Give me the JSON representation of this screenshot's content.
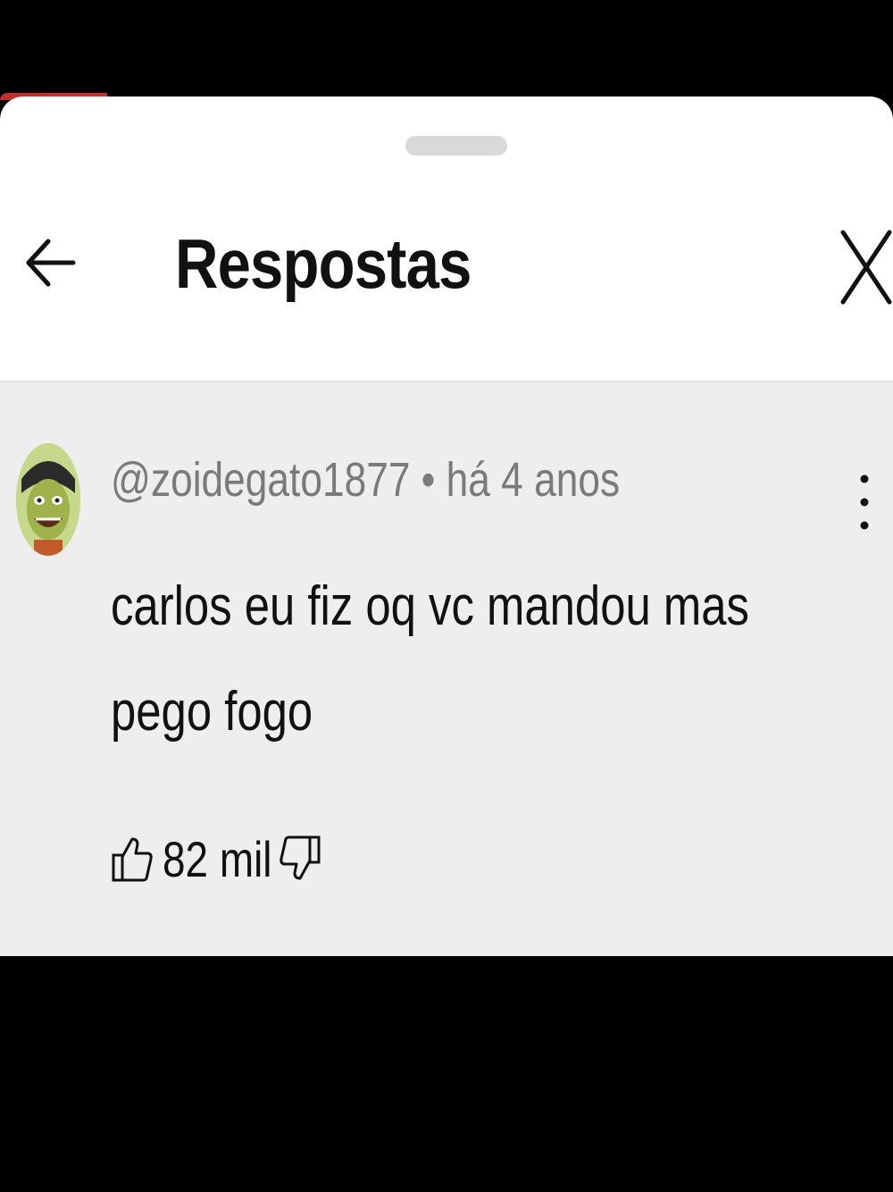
{
  "header": {
    "title": "Respostas",
    "back_icon": "arrow-left-icon",
    "close_icon": "close-icon"
  },
  "comment": {
    "author": "@zoidegato1877",
    "separator": "•",
    "time": "há 4 anos",
    "text": "carlos eu fiz oq vc mandou mas pego fogo",
    "likes": "82 mil",
    "like_icon": "thumbs-up-icon",
    "dislike_icon": "thumbs-down-icon",
    "more_icon": "more-vertical-icon"
  },
  "colors": {
    "sheet_bg": "#ffffff",
    "comment_bg": "#eeeeee",
    "meta_text": "#7a7a7a",
    "accent_red": "#c4302b"
  }
}
